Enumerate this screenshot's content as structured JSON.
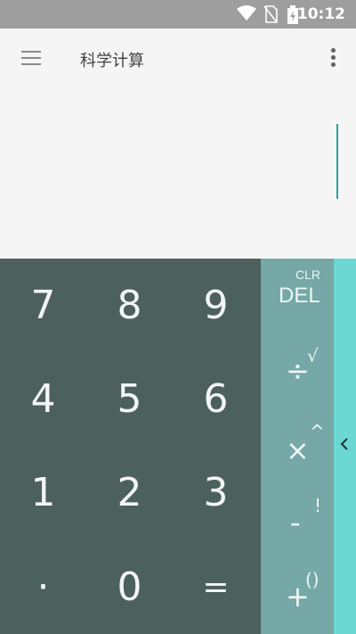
{
  "status_bar": {
    "time": "10:12"
  },
  "toolbar": {
    "title": "科学计算"
  },
  "keypad": {
    "digits": [
      "7",
      "8",
      "9",
      "4",
      "5",
      "6",
      "1",
      "2",
      "3",
      "·",
      "0",
      "="
    ]
  },
  "operators": {
    "clr": "CLR",
    "del": "DEL",
    "divide": "÷",
    "sqrt": "√",
    "multiply": "×",
    "power": "^",
    "minus": "-",
    "factorial": "!",
    "plus": "+",
    "paren": "()"
  },
  "icons": {
    "menu": "menu-icon",
    "overflow": "more-vert-icon",
    "side": "chevron-left-icon"
  },
  "colors": {
    "numpad": "#4c605c",
    "ops": "#75a8a6",
    "side_panel": "#6bd8d3",
    "cursor": "#26a69a"
  }
}
